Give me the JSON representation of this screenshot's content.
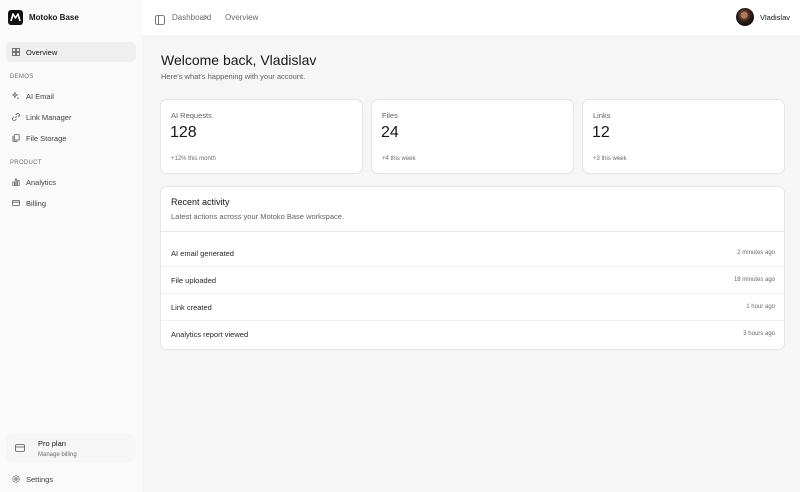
{
  "brand": {
    "name": "Motoko Base",
    "logo_icon": "m-logo-icon"
  },
  "sidebar": {
    "overview": {
      "label": "Overview",
      "icon": "grid-icon"
    },
    "sections": [
      {
        "label": "DEMOS",
        "items": [
          {
            "label": "AI Email",
            "icon": "sparkles-icon"
          },
          {
            "label": "Link Manager",
            "icon": "link-icon"
          },
          {
            "label": "File Storage",
            "icon": "files-icon"
          }
        ]
      },
      {
        "label": "PRODUCT",
        "items": [
          {
            "label": "Analytics",
            "icon": "bar-chart-icon"
          },
          {
            "label": "Billing",
            "icon": "credit-card-icon"
          }
        ]
      }
    ],
    "plan": {
      "title": "Pro plan",
      "subtitle": "Manage billing",
      "icon": "card-icon"
    },
    "settings": {
      "label": "Settings",
      "icon": "gear-icon"
    }
  },
  "topbar": {
    "toggle_icon": "sidebar-toggle-icon",
    "breadcrumb": [
      "Dashboard",
      "Overview"
    ],
    "user": {
      "name": "Vladislav"
    }
  },
  "welcome": {
    "title": "Welcome back, Vladislav",
    "subtitle": "Here's what's happening with your account."
  },
  "stats": [
    {
      "label": "AI Requests",
      "value": "128",
      "delta": "+12% this month"
    },
    {
      "label": "Files",
      "value": "24",
      "delta": "+4 this week"
    },
    {
      "label": "Links",
      "value": "12",
      "delta": "+3 this week"
    }
  ],
  "activity": {
    "title": "Recent activity",
    "subtitle": "Latest actions across your Motoko Base workspace.",
    "rows": [
      {
        "event": "AI email generated",
        "time": "2 minutes ago"
      },
      {
        "event": "File uploaded",
        "time": "18 minutes ago"
      },
      {
        "event": "Link created",
        "time": "1 hour ago"
      },
      {
        "event": "Analytics report viewed",
        "time": "3 hours ago"
      }
    ]
  }
}
